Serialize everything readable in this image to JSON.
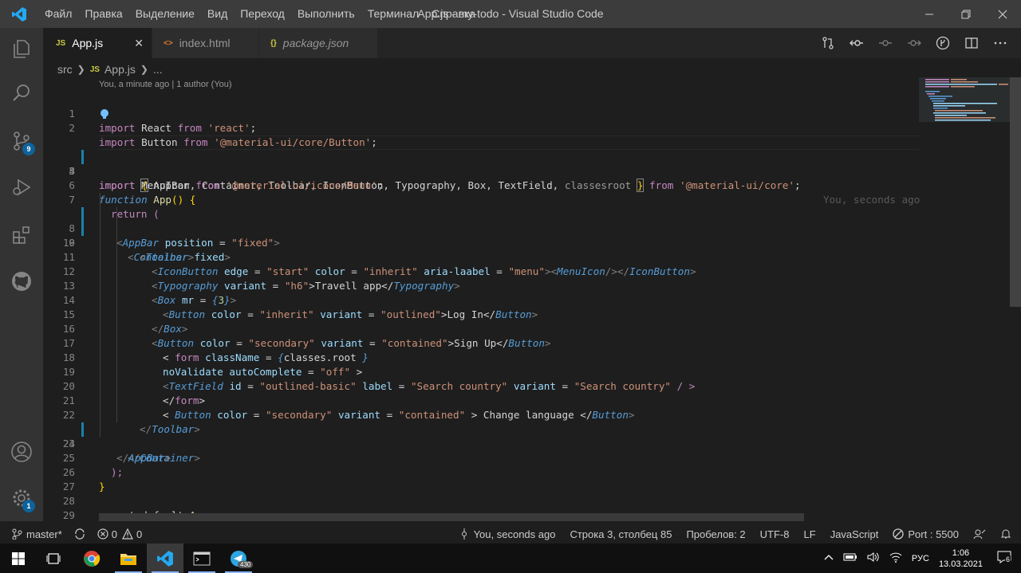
{
  "window": {
    "title": "App.js - my-todo - Visual Studio Code",
    "menu": [
      "Файл",
      "Правка",
      "Выделение",
      "Вид",
      "Переход",
      "Выполнить",
      "Терминал",
      "Справка"
    ]
  },
  "activity_bar": {
    "items": [
      "explorer",
      "search",
      "source-control",
      "run-debug",
      "extensions",
      "github"
    ],
    "scm_badge": "9",
    "settings_badge": "1"
  },
  "tabs": [
    {
      "label": "App.js",
      "icon": "JS",
      "active": true
    },
    {
      "label": "index.html",
      "icon": "<>",
      "active": false
    },
    {
      "label": "package.json",
      "icon": "{}",
      "active": false
    }
  ],
  "breadcrumb": {
    "folder": "src",
    "file_icon": "JS",
    "file": "App.js",
    "more": "..."
  },
  "codelens": "You, a minute ago | 1 author (You)",
  "ghost_blame": "You, seconds ago",
  "line_numbers": [
    "1",
    "2",
    "3",
    "4",
    "5",
    "6",
    "7",
    "8",
    "9",
    "10",
    "11",
    "12",
    "13",
    "14",
    "15",
    "16",
    "17",
    "18",
    "19",
    "20",
    "21",
    "22",
    "23",
    "24",
    "25",
    "26",
    "27",
    "28",
    "29"
  ],
  "code": {
    "l1": [
      "import",
      " React ",
      "from",
      " ",
      "'react'",
      ";"
    ],
    "l2": [
      "import",
      " Button ",
      "from",
      " ",
      "'@material-ui/core/Button'",
      ";"
    ],
    "l3": [
      "import",
      " ",
      "{",
      " AppBar, Container, Toolbar, IconButton, Typography, Box, TextField, ",
      "classesroot",
      " ",
      "}",
      " ",
      "from",
      " ",
      "'@material-ui/core'",
      ";"
    ],
    "l4": [
      "import",
      " MenuIcon ",
      "from",
      " ",
      "'@material-ui/icons/Menu'",
      ";"
    ],
    "l6": [
      "function",
      " ",
      "App",
      "() {"
    ],
    "l7": [
      "return",
      " ("
    ],
    "l8": [
      "<",
      "AppBar",
      " ",
      "position",
      " = ",
      "\"fixed\"",
      ">"
    ],
    "l9": [
      "<",
      "Container",
      " ",
      "fixed",
      ">"
    ],
    "l10": [
      "<",
      "Toolbar",
      ">"
    ],
    "l11": [
      "<",
      "IconButton",
      " ",
      "edge",
      " = ",
      "\"start\"",
      " ",
      "color",
      " = ",
      "\"inherit\"",
      " ",
      "aria-laabel",
      " = ",
      "\"menu\"",
      "><",
      "MenuIcon",
      "/></",
      "IconButton",
      ">"
    ],
    "l12": [
      "<",
      "Typography",
      " ",
      "variant",
      " = ",
      "\"h6\"",
      ">Travell app</",
      "Typography",
      ">"
    ],
    "l13": [
      "<",
      "Box",
      " ",
      "mr",
      " = ",
      "{",
      "3",
      "}",
      ">"
    ],
    "l14": [
      "<",
      "Button",
      " ",
      "color",
      " = ",
      "\"inherit\"",
      " ",
      "variant",
      " = ",
      "\"outlined\"",
      ">Log In</",
      "Button",
      ">"
    ],
    "l15": [
      "</",
      "Box",
      ">"
    ],
    "l16": [
      "<",
      "Button",
      " ",
      "color",
      " = ",
      "\"secondary\"",
      " ",
      "variant",
      " = ",
      "\"contained\"",
      ">Sign Up</",
      "Button",
      ">"
    ],
    "l17": [
      "< ",
      "form",
      " ",
      "className",
      " = ",
      "{",
      "classes.root",
      " }"
    ],
    "l18": [
      "noValidate",
      " ",
      "autoComplete",
      " = ",
      "\"off\"",
      " >"
    ],
    "l19": [
      "<",
      "TextField",
      " ",
      "id",
      " = ",
      "\"outlined-basic\"",
      " ",
      "label",
      " = ",
      "\"Search country\"",
      " ",
      "variant",
      " = ",
      "\"Search country\"",
      " / >"
    ],
    "l20": [
      "</",
      "form",
      ">"
    ],
    "l21": [
      "< ",
      "Button",
      " ",
      "color",
      " = ",
      "\"secondary\"",
      " ",
      "variant",
      " = ",
      "\"contained\"",
      " > Change language </",
      "Button",
      ">"
    ],
    "l22": [
      "</",
      "Toolbar",
      ">"
    ],
    "l23": [
      "</",
      "Container",
      ">"
    ],
    "l24": [
      "</",
      "AppBar",
      ">"
    ],
    "l25": [
      ");"
    ],
    "l26": [
      "}"
    ],
    "l28": [
      "export default ",
      "App",
      ";"
    ]
  },
  "status_bar": {
    "branch": "master*",
    "errors": "0",
    "warnings": "0",
    "blame": "You, seconds ago",
    "position": "Строка 3, столбец 85",
    "spaces": "Пробелов: 2",
    "encoding": "UTF-8",
    "eol": "LF",
    "language": "JavaScript",
    "port": "Port : 5500"
  },
  "taskbar": {
    "lang": "РУС",
    "time": "1:06",
    "date": "13.03.2021",
    "notif_count": "6",
    "telegram_badge": "430"
  },
  "colors": {
    "accent": "#007acc",
    "keyword": "#c586c0",
    "string": "#ce9178",
    "tag": "#569cd6",
    "attr": "#9cdcfe"
  }
}
